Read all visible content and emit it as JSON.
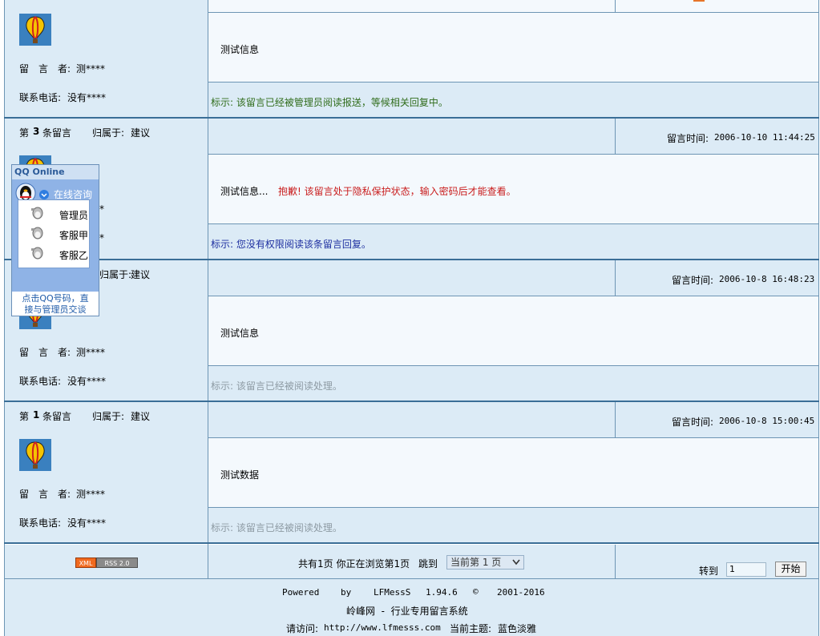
{
  "messages": [
    {
      "header": "",
      "author_label": "留　言　者:",
      "author": "测****",
      "phone_label": "联系电话:",
      "phone": "没有****",
      "content": "测试信息",
      "status": "标示: 该留言已经被管理员阅读报送，等候相关回复中。"
    },
    {
      "number_prefix": "第",
      "number": "3",
      "number_suffix": "条留言",
      "category_label": "归属于:",
      "category": "建议",
      "time_label": "留言时间:",
      "time": "2006-10-10 11:44:25",
      "content": "测试信息...",
      "content_warning": "抱歉! 该留言处于隐私保护状态，输入密码后才能查看。",
      "author_tail": "*",
      "phone_tail": "*",
      "status": "标示: 您没有权限阅读该条留言回复。"
    },
    {
      "category_tail": "归属于:",
      "category": "建议",
      "time_label": "留言时间:",
      "time": "2006-10-8 16:48:23",
      "author_label": "留　言　者:",
      "author": "测****",
      "phone_label": "联系电话:",
      "phone": "没有****",
      "content": "测试信息",
      "status": "标示: 该留言已经被阅读处理。"
    },
    {
      "number_prefix": "第",
      "number": "1",
      "number_suffix": "条留言",
      "category_label": "归属于:",
      "category": "建议",
      "time_label": "留言时间:",
      "time": "2006-10-8 15:00:45",
      "author_label": "留　言　者:",
      "author": "测****",
      "phone_label": "联系电话:",
      "phone": "没有****",
      "content": "测试数据",
      "status": "标示: 该留言已经被阅读处理。"
    }
  ],
  "qq_widget": {
    "title": "QQ Online",
    "consult": "在线咨询",
    "contacts": [
      "管理员",
      "客服甲",
      "客服乙"
    ],
    "footer_line1": "点击QQ号码，直",
    "footer_line2": "接与管理员交谈"
  },
  "pagination": {
    "rss_left": "XML",
    "rss_right": "RSS 2.0",
    "summary": "共有1页 你正在浏览第1页",
    "jump_label": "跳到",
    "select_value": "当前第 1 页",
    "goto_label": "转到",
    "goto_value": "1",
    "goto_button": "开始"
  },
  "footer": {
    "powered": "Powered",
    "by": "by",
    "product": "LFMessS",
    "version": "1.94.6",
    "copyright_symbol": "©",
    "years": "2001-2016",
    "line2": "岭峰网  -  行业专用留言系统",
    "visit_label": "请访问:",
    "url": "http://www.lfmesss.com",
    "theme_label": "当前主题:",
    "theme": "蓝色淡雅"
  },
  "colors": {
    "sidebar_bg": "#dcebf6",
    "content_bg": "#f4f9fd",
    "border": "#3a6e97",
    "status_green": "#2f6c1a",
    "status_gray": "#8d9aa3",
    "status_blue": "#1d2fa0",
    "warning_red": "#c91d1d"
  }
}
